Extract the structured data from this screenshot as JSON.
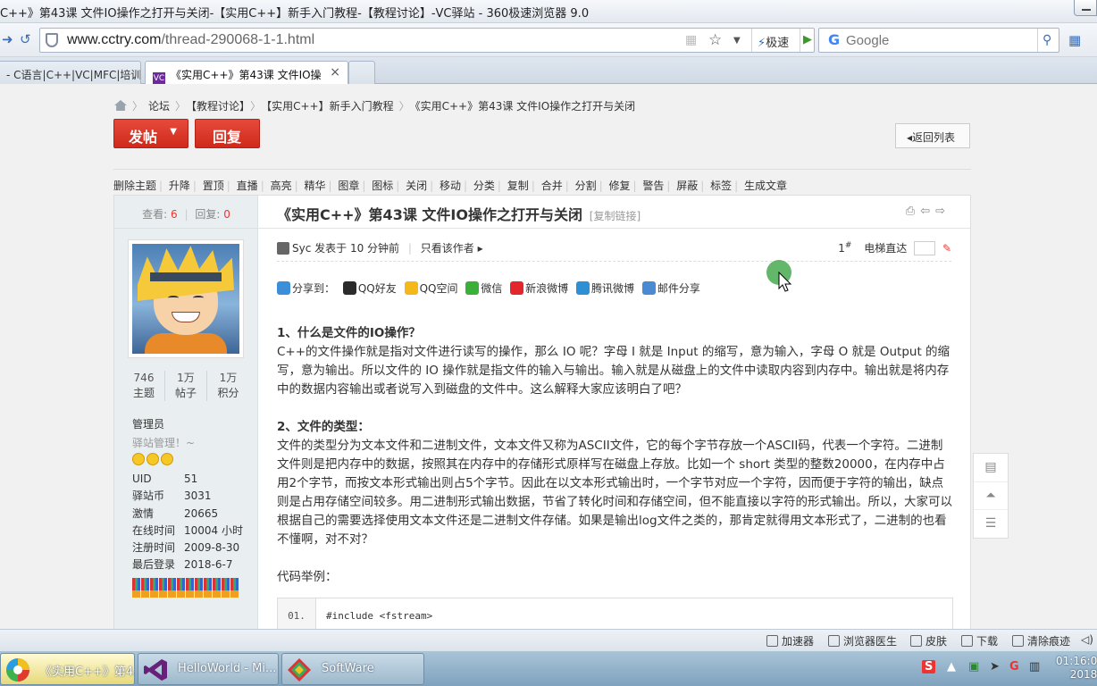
{
  "window": {
    "title": "C++》第43课 文件IO操作之打开与关闭-【实用C++】新手入门教程-【教程讨论】-VC驿站 - 360极速浏览器 9.0"
  },
  "toolbar": {
    "url_host": "www.cctry.com",
    "url_path": "/thread-290068-1-1.html",
    "speed_label": "极速",
    "search_placeholder": "Google"
  },
  "tabs": [
    {
      "label": "- C语言|C++|VC|MFC|培训",
      "active": false
    },
    {
      "label": "《实用C++》第43课 文件IO操",
      "active": true,
      "close": "×"
    }
  ],
  "breadcrumb": [
    "论坛",
    "【教程讨论】",
    "【实用C++】新手入门教程",
    "《实用C++》第43课 文件IO操作之打开与关闭"
  ],
  "buttons": {
    "post": "发帖",
    "reply": "回复",
    "back_to_list": "返回列表"
  },
  "mod_actions": [
    "删除主题",
    "升降",
    "置顶",
    "直播",
    "高亮",
    "精华",
    "图章",
    "图标",
    "关闭",
    "移动",
    "分类",
    "复制",
    "合并",
    "分割",
    "修复",
    "警告",
    "屏蔽",
    "标签",
    "生成文章"
  ],
  "author": {
    "views_label": "查看:",
    "views": "6",
    "replies_label": "回复:",
    "replies": "0",
    "stats": [
      {
        "value": "746",
        "label": "主题"
      },
      {
        "value": "1万",
        "label": "帖子"
      },
      {
        "value": "1万",
        "label": "积分"
      }
    ],
    "role": "管理员",
    "signature": "驿站管理！~",
    "profile": [
      {
        "key": "UID",
        "value": "51"
      },
      {
        "key": "驿站币",
        "value": "3031"
      },
      {
        "key": "激情",
        "value": "20665"
      },
      {
        "key": "在线时间",
        "value": "10004 小时"
      },
      {
        "key": "注册时间",
        "value": "2009-8-30"
      },
      {
        "key": "最后登录",
        "value": "2018-6-7"
      }
    ]
  },
  "post": {
    "title": "《实用C++》第43课 文件IO操作之打开与关闭",
    "copy_link": "[复制链接]",
    "meta_author": "Syc",
    "meta_time": "发表于 10 分钟前",
    "meta_only_author": "只看该作者",
    "floor": "1",
    "floor_sup": "#",
    "elevator": "电梯直达",
    "share_label": "分享到：",
    "share": [
      "QQ好友",
      "QQ空间",
      "微信",
      "新浪微博",
      "腾讯微博",
      "邮件分享"
    ],
    "h1": "1、什么是文件的IO操作？",
    "p1": "C++的文件操作就是指对文件进行读写的操作，那么 IO 呢？字母 I 就是 Input 的缩写，意为输入，字母 O 就是 Output 的缩写，意为输出。所以文件的 IO 操作就是指文件的输入与输出。输入就是从磁盘上的文件中读取内容到内存中。输出就是将内存中的数据内容输出或者说写入到磁盘的文件中。这么解释大家应该明白了吧？",
    "h2": "2、文件的类型：",
    "p2": "文件的类型分为文本文件和二进制文件，文本文件又称为ASCII文件，它的每个字节存放一个ASCII码，代表一个字符。二进制文件则是把内存中的数据，按照其在内存中的存储形式原样写在磁盘上存放。比如一个 short 类型的整数20000，在内存中占用2个字节，而按文本形式输出则占5个字节。因此在以文本形式输出时，一个字节对应一个字符，因而便于字符的输出，缺点则是占用存储空间较多。用二进制形式输出数据，节省了转化时间和存储空间，但不能直接以字符的形式输出。所以，大家可以根据自己的需要选择使用文本文件还是二进制文件存储。如果是输出log文件之类的，那肯定就得用文本形式了，二进制的也看不懂啊，对不对？",
    "code_intro": "代码举例：",
    "code_line_no": "01.",
    "code_line": "#include <fstream>"
  },
  "statusbar": [
    "加速器",
    "浏览器医生",
    "皮肤",
    "下载",
    "清除痕迹"
  ],
  "taskbar": {
    "items": [
      "《实用C++》第4...",
      "HelloWorld - Mi...",
      "SoftWare"
    ],
    "clock_time": "01:16:0",
    "clock_date": "2018"
  }
}
